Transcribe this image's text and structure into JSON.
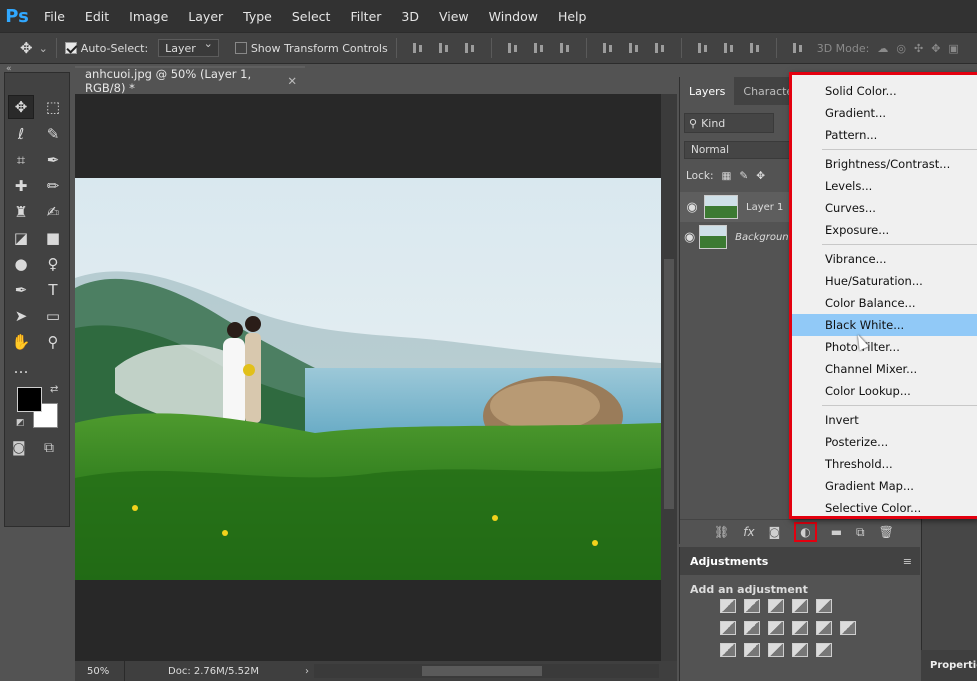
{
  "app": {
    "logo": "Ps"
  },
  "menu": [
    "File",
    "Edit",
    "Image",
    "Layer",
    "Type",
    "Select",
    "Filter",
    "3D",
    "View",
    "Window",
    "Help"
  ],
  "options": {
    "auto_select_label": "Auto-Select:",
    "auto_select_value": "Layer",
    "show_transform_label": "Show Transform Controls",
    "mode_3d_label": "3D Mode:"
  },
  "document": {
    "tab_title": "anhcuoi.jpg @ 50% (Layer 1, RGB/8) *",
    "zoom": "50%",
    "doc_size": "Doc: 2.76M/5.52M"
  },
  "layers_panel": {
    "tabs": [
      "Layers",
      "Character"
    ],
    "kind_label": "Kind",
    "blend_mode": "Normal",
    "lock_label": "Lock:",
    "layers": [
      {
        "name": "Layer 1",
        "visible": true
      },
      {
        "name": "Background",
        "visible": true
      }
    ]
  },
  "adjustments": {
    "title": "Adjustments",
    "subtitle": "Add an adjustment"
  },
  "properties_tab": "Properties",
  "adjustment_menu": {
    "groups": [
      [
        "Solid Color...",
        "Gradient...",
        "Pattern..."
      ],
      [
        "Brightness/Contrast...",
        "Levels...",
        "Curves...",
        "Exposure..."
      ],
      [
        "Vibrance...",
        "Hue/Saturation...",
        "Color Balance...",
        "Black  White...",
        "Photo Filter...",
        "Channel Mixer...",
        "Color Lookup..."
      ],
      [
        "Invert",
        "Posterize...",
        "Threshold...",
        "Gradient Map...",
        "Selective Color..."
      ]
    ],
    "highlighted": "Black  White...",
    "highlight_color": "#91c9f7",
    "callout_color": "#e3000f"
  }
}
